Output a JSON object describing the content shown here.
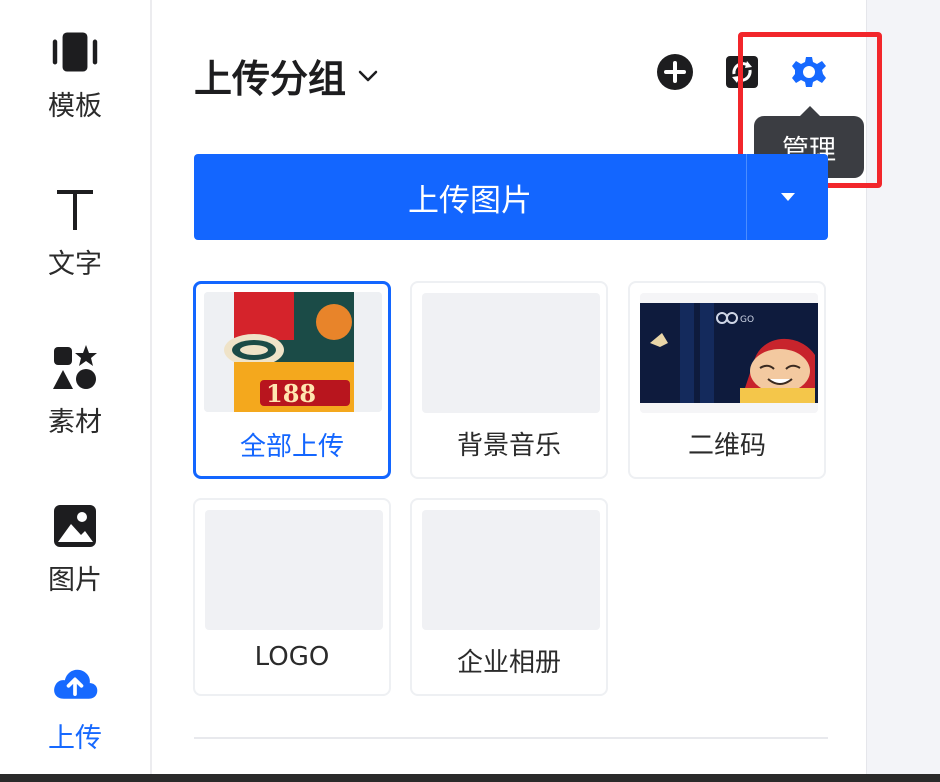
{
  "sidebar": {
    "items": [
      {
        "label": "模板",
        "icon": "template-icon"
      },
      {
        "label": "文字",
        "icon": "text-icon"
      },
      {
        "label": "素材",
        "icon": "shapes-icon"
      },
      {
        "label": "图片",
        "icon": "image-icon"
      },
      {
        "label": "上传",
        "icon": "upload-cloud-icon",
        "active": true
      }
    ]
  },
  "header": {
    "title": "上传分组",
    "tooltip": "管理"
  },
  "upload_button": {
    "label": "上传图片"
  },
  "groups": [
    {
      "label": "全部上传",
      "selected": true
    },
    {
      "label": "背景音乐",
      "selected": false
    },
    {
      "label": "二维码",
      "selected": false
    },
    {
      "label": "LOGO",
      "selected": false
    },
    {
      "label": "企业相册",
      "selected": false
    }
  ],
  "thumb_text": {
    "price": "188",
    "brand": "GO"
  },
  "colors": {
    "accent": "#1366ff",
    "highlight": "#f2262b",
    "tooltip_bg": "#3b3d42"
  }
}
